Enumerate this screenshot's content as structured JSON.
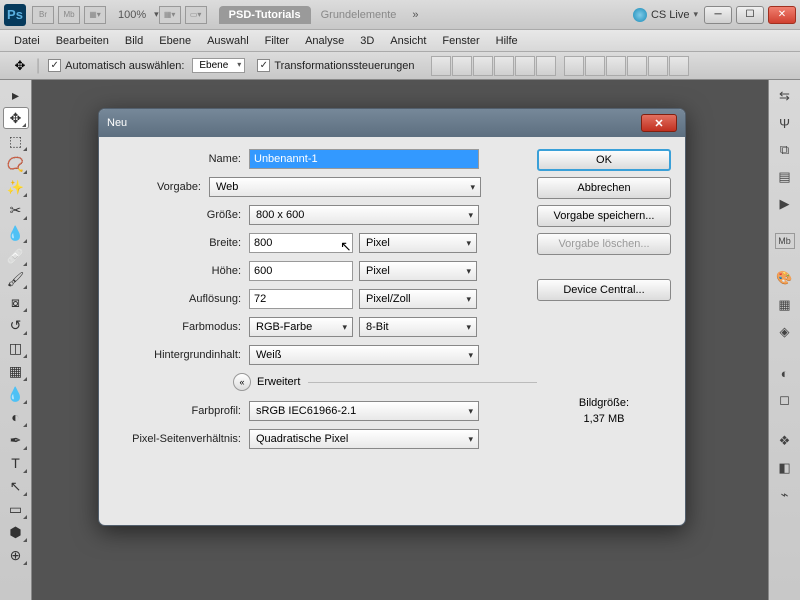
{
  "titlebar": {
    "zoom": "100%",
    "tab_active": "PSD-Tutorials",
    "tab_inactive": "Grundelemente",
    "cslive": "CS Live"
  },
  "menu": [
    "Datei",
    "Bearbeiten",
    "Bild",
    "Ebene",
    "Auswahl",
    "Filter",
    "Analyse",
    "3D",
    "Ansicht",
    "Fenster",
    "Hilfe"
  ],
  "optbar": {
    "auto_select": "Automatisch auswählen:",
    "auto_select_value": "Ebene",
    "transform": "Transformationssteuerungen"
  },
  "dialog": {
    "title": "Neu",
    "labels": {
      "name": "Name:",
      "preset": "Vorgabe:",
      "size": "Größe:",
      "width": "Breite:",
      "height": "Höhe:",
      "resolution": "Auflösung:",
      "colormode": "Farbmodus:",
      "background": "Hintergrundinhalt:",
      "advanced": "Erweitert",
      "profile": "Farbprofil:",
      "aspect": "Pixel-Seitenverhältnis:"
    },
    "values": {
      "name": "Unbenannt-1",
      "preset": "Web",
      "size": "800 x 600",
      "width": "800",
      "height": "600",
      "resolution": "72",
      "width_unit": "Pixel",
      "height_unit": "Pixel",
      "res_unit": "Pixel/Zoll",
      "colormode": "RGB-Farbe",
      "depth": "8-Bit",
      "background": "Weiß",
      "profile": "sRGB IEC61966-2.1",
      "aspect": "Quadratische Pixel"
    },
    "buttons": {
      "ok": "OK",
      "cancel": "Abbrechen",
      "save_preset": "Vorgabe speichern...",
      "delete_preset": "Vorgabe löschen...",
      "device_central": "Device Central..."
    },
    "sizeinfo": {
      "label": "Bildgröße:",
      "value": "1,37 MB"
    }
  }
}
